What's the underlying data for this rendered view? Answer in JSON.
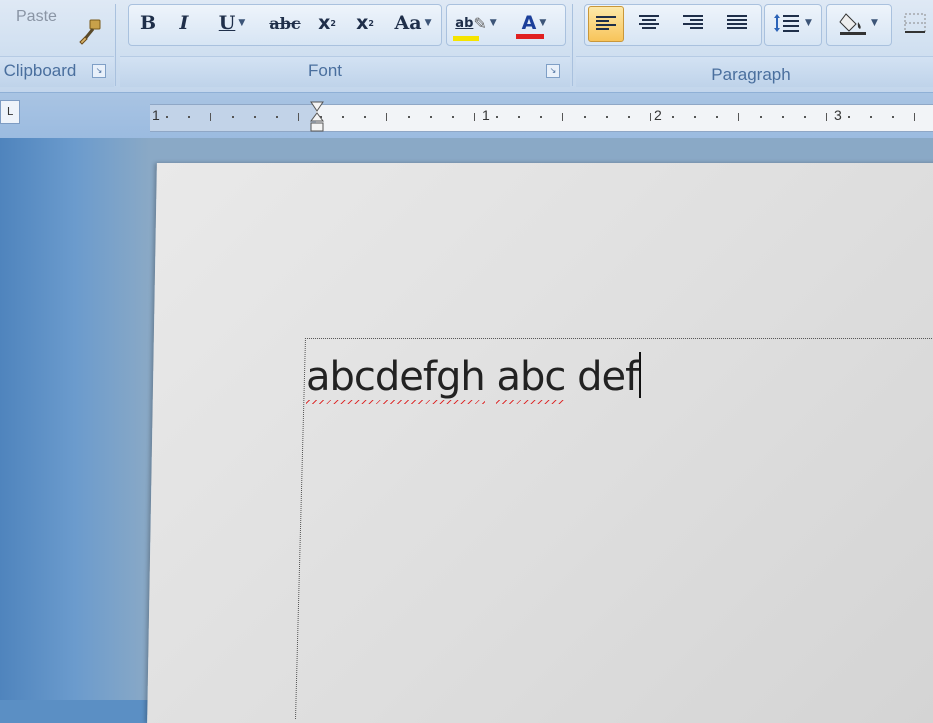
{
  "ribbon": {
    "paste_label": "Paste",
    "groups": {
      "clipboard": "Clipboard",
      "font": "Font",
      "paragraph": "Paragraph"
    },
    "font_buttons": {
      "bold": "B",
      "italic": "I",
      "underline": "U",
      "strikethrough": "abc",
      "subscript": "x",
      "superscript": "x",
      "change_case": "Aa",
      "highlight": "ab",
      "font_color": "A"
    },
    "colors": {
      "highlight": "#f5e400",
      "font_color": "#e02020",
      "active_align": "#f8c45a",
      "spelling_error": "#dd3333"
    }
  },
  "ruler": {
    "numbers": [
      "1",
      "1",
      "2",
      "3"
    ]
  },
  "document": {
    "words": [
      {
        "text": "abcdefgh",
        "misspelled": true
      },
      {
        "text": "abc",
        "misspelled": true
      },
      {
        "text": "def",
        "misspelled": false
      }
    ]
  }
}
